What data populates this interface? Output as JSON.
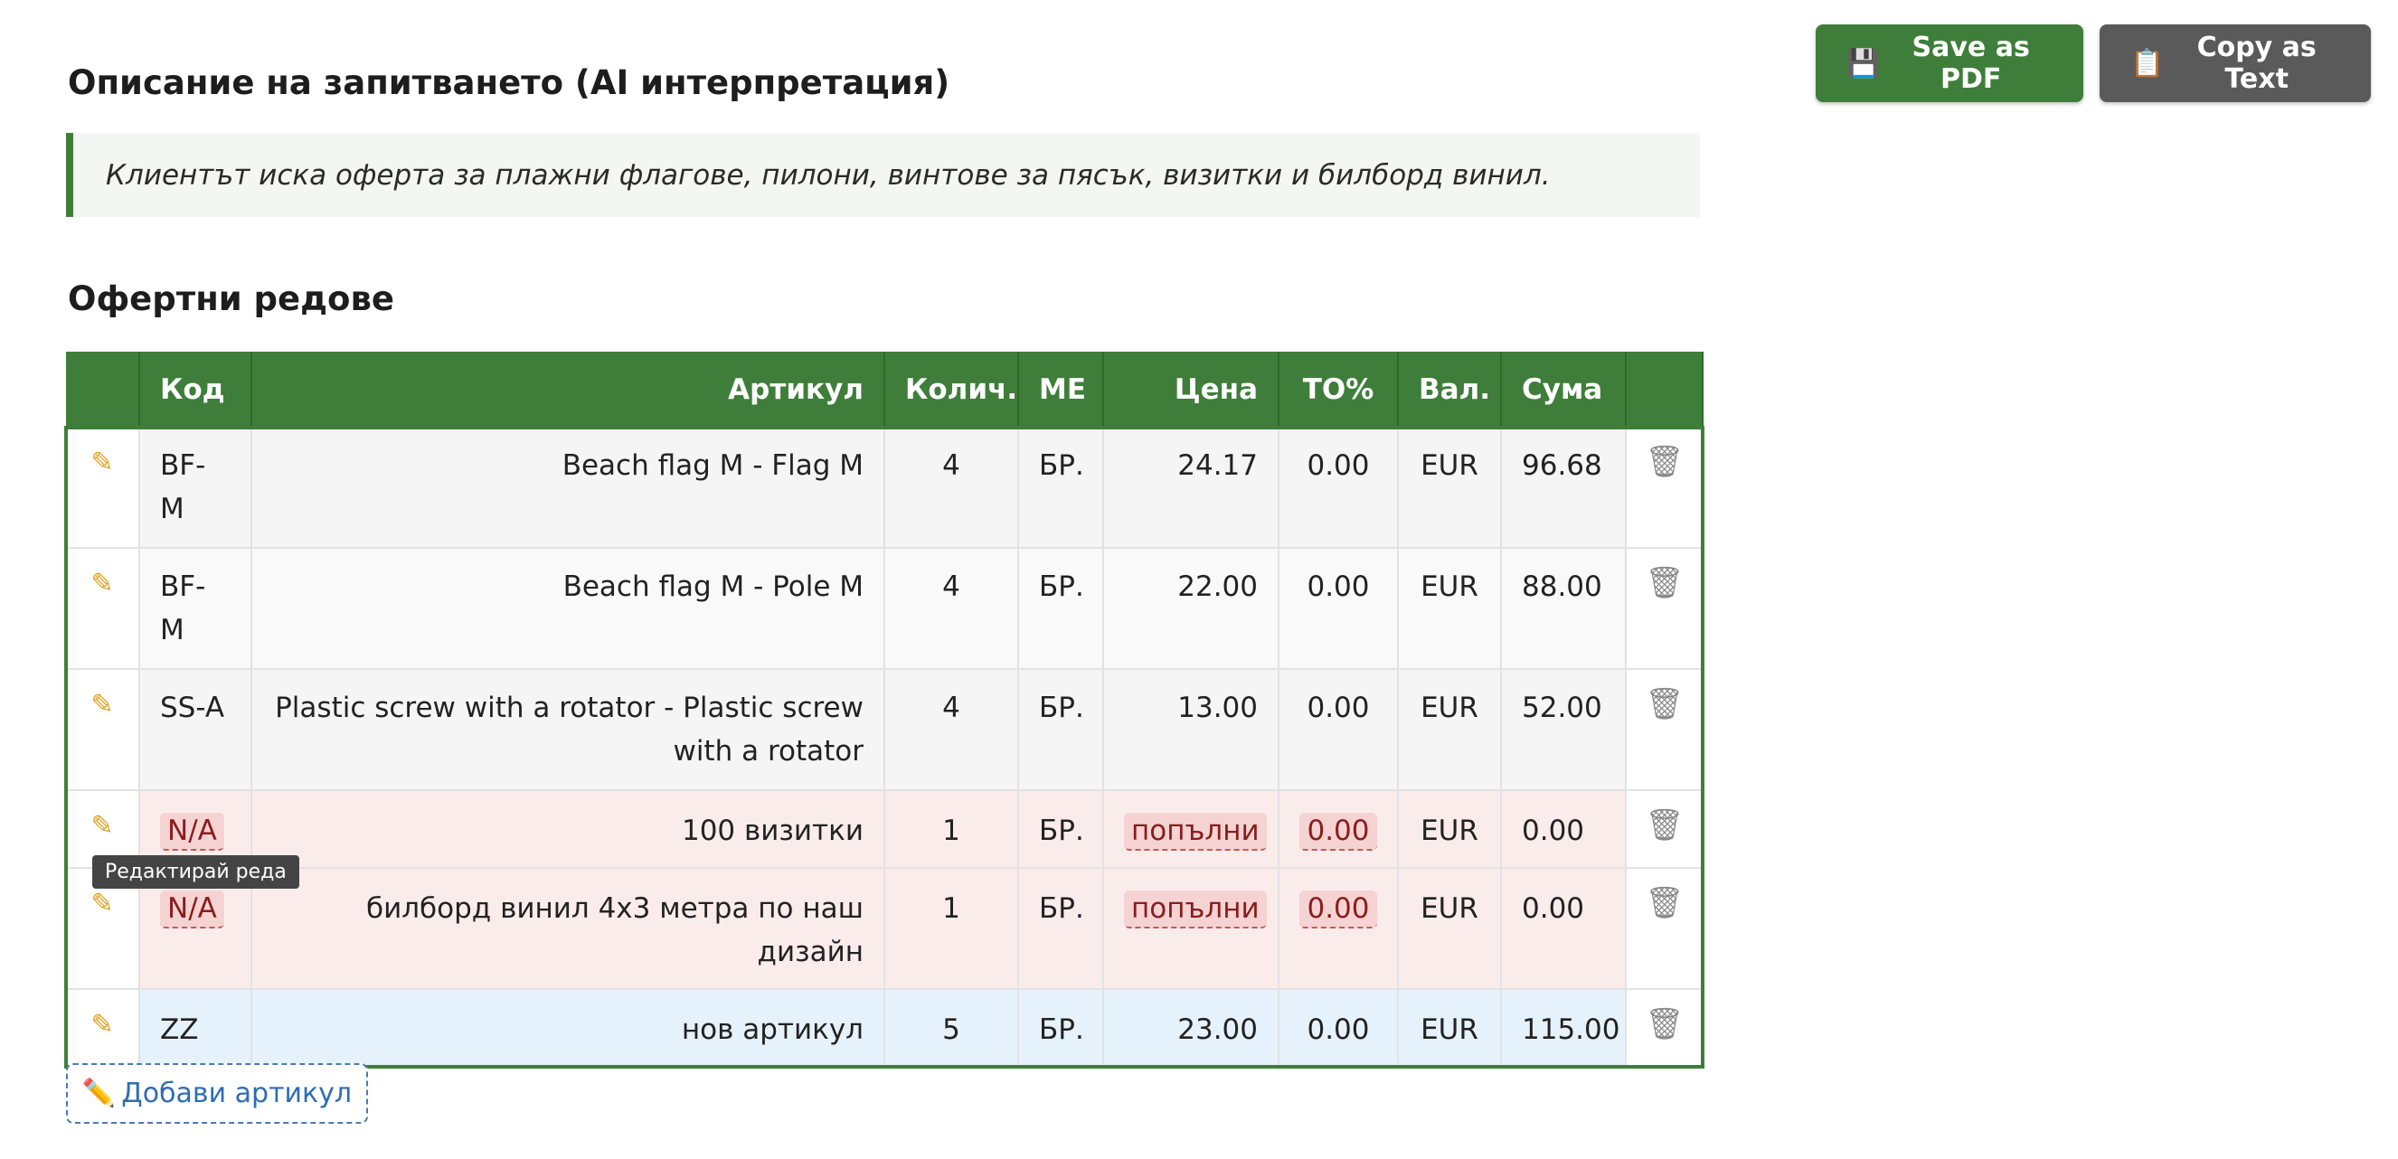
{
  "actions": {
    "pdf_icon": "💾",
    "pdf_label": "Save as PDF",
    "text_icon": "📋",
    "text_label": "Copy as Text"
  },
  "description": {
    "heading": "Описание на запитването (AI интерпретация)",
    "text": "Клиентът иска оферта за плажни флагове, пилони, винтове за пясък, визитки и билборд винил."
  },
  "lines": {
    "heading": "Офертни редове",
    "columns": [
      "Код",
      "Артикул",
      "Колич.",
      "МЕ",
      "Цена",
      "ТО%",
      "Вал.",
      "Сума"
    ],
    "rows": [
      {
        "code": "BF-M",
        "item": "Beach flag M - Flag M",
        "qty": "4",
        "unit": "БР.",
        "price": "24.17",
        "disc": "0.00",
        "cur": "EUR",
        "sum": "96.68"
      },
      {
        "code": "BF-M",
        "item": "Beach flag M - Pole M",
        "qty": "4",
        "unit": "БР.",
        "price": "22.00",
        "disc": "0.00",
        "cur": "EUR",
        "sum": "88.00"
      },
      {
        "code": "SS-A",
        "item": "Plastic screw with a rotator - Plastic screw with a rotator",
        "qty": "4",
        "unit": "БР.",
        "price": "13.00",
        "disc": "0.00",
        "cur": "EUR",
        "sum": "52.00"
      },
      {
        "code": "N/A",
        "item": "100 визитки",
        "qty": "1",
        "unit": "БР.",
        "price": "попълни",
        "disc": "0.00",
        "cur": "EUR",
        "sum": "0.00"
      },
      {
        "code": "N/A",
        "item": "билборд винил 4x3 метра по наш дизайн",
        "qty": "1",
        "unit": "БР.",
        "price": "попълни",
        "disc": "0.00",
        "cur": "EUR",
        "sum": "0.00"
      },
      {
        "code": "ZZ",
        "item": "нов артикул",
        "qty": "5",
        "unit": "БР.",
        "price": "23.00",
        "disc": "0.00",
        "cur": "EUR",
        "sum": "115.00"
      }
    ]
  },
  "tooltip": "Редактирай реда",
  "add_button": {
    "icon": "✏️",
    "label": "Добави артикул"
  },
  "icons": {
    "edit": "pencil-icon",
    "delete": "trash-icon"
  },
  "colors": {
    "accent": "#3f7e3a",
    "error_bg": "#fbecec",
    "new_bg": "#e6f2fb"
  }
}
